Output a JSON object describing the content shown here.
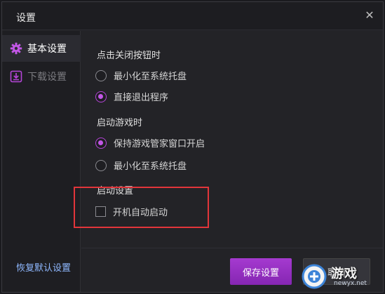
{
  "window": {
    "title": "设置",
    "close_icon": "close-icon"
  },
  "sidebar": {
    "items": [
      {
        "label": "基本设置",
        "icon": "gear-icon",
        "active": true
      },
      {
        "label": "下载设置",
        "icon": "download-icon",
        "active": false
      }
    ],
    "restore_label": "恢复默认设置"
  },
  "sections": [
    {
      "title": "点击关闭按钮时",
      "options": [
        {
          "label": "最小化至系统托盘",
          "checked": false
        },
        {
          "label": "直接退出程序",
          "checked": true
        }
      ]
    },
    {
      "title": "启动游戏时",
      "options": [
        {
          "label": "保持游戏管家窗口开启",
          "checked": true
        },
        {
          "label": "最小化至系统托盘",
          "checked": false
        }
      ]
    },
    {
      "title": "启动设置",
      "checkbox": {
        "label": "开机自动启动",
        "checked": false
      }
    }
  ],
  "footer": {
    "save_label": "保存设置",
    "cancel_label": "取消"
  },
  "watermark": {
    "text": "游戏",
    "url": "newyx.net"
  },
  "colors": {
    "accent": "#b545d8",
    "highlight_box": "#e2353a",
    "link": "#8fb8ff"
  }
}
